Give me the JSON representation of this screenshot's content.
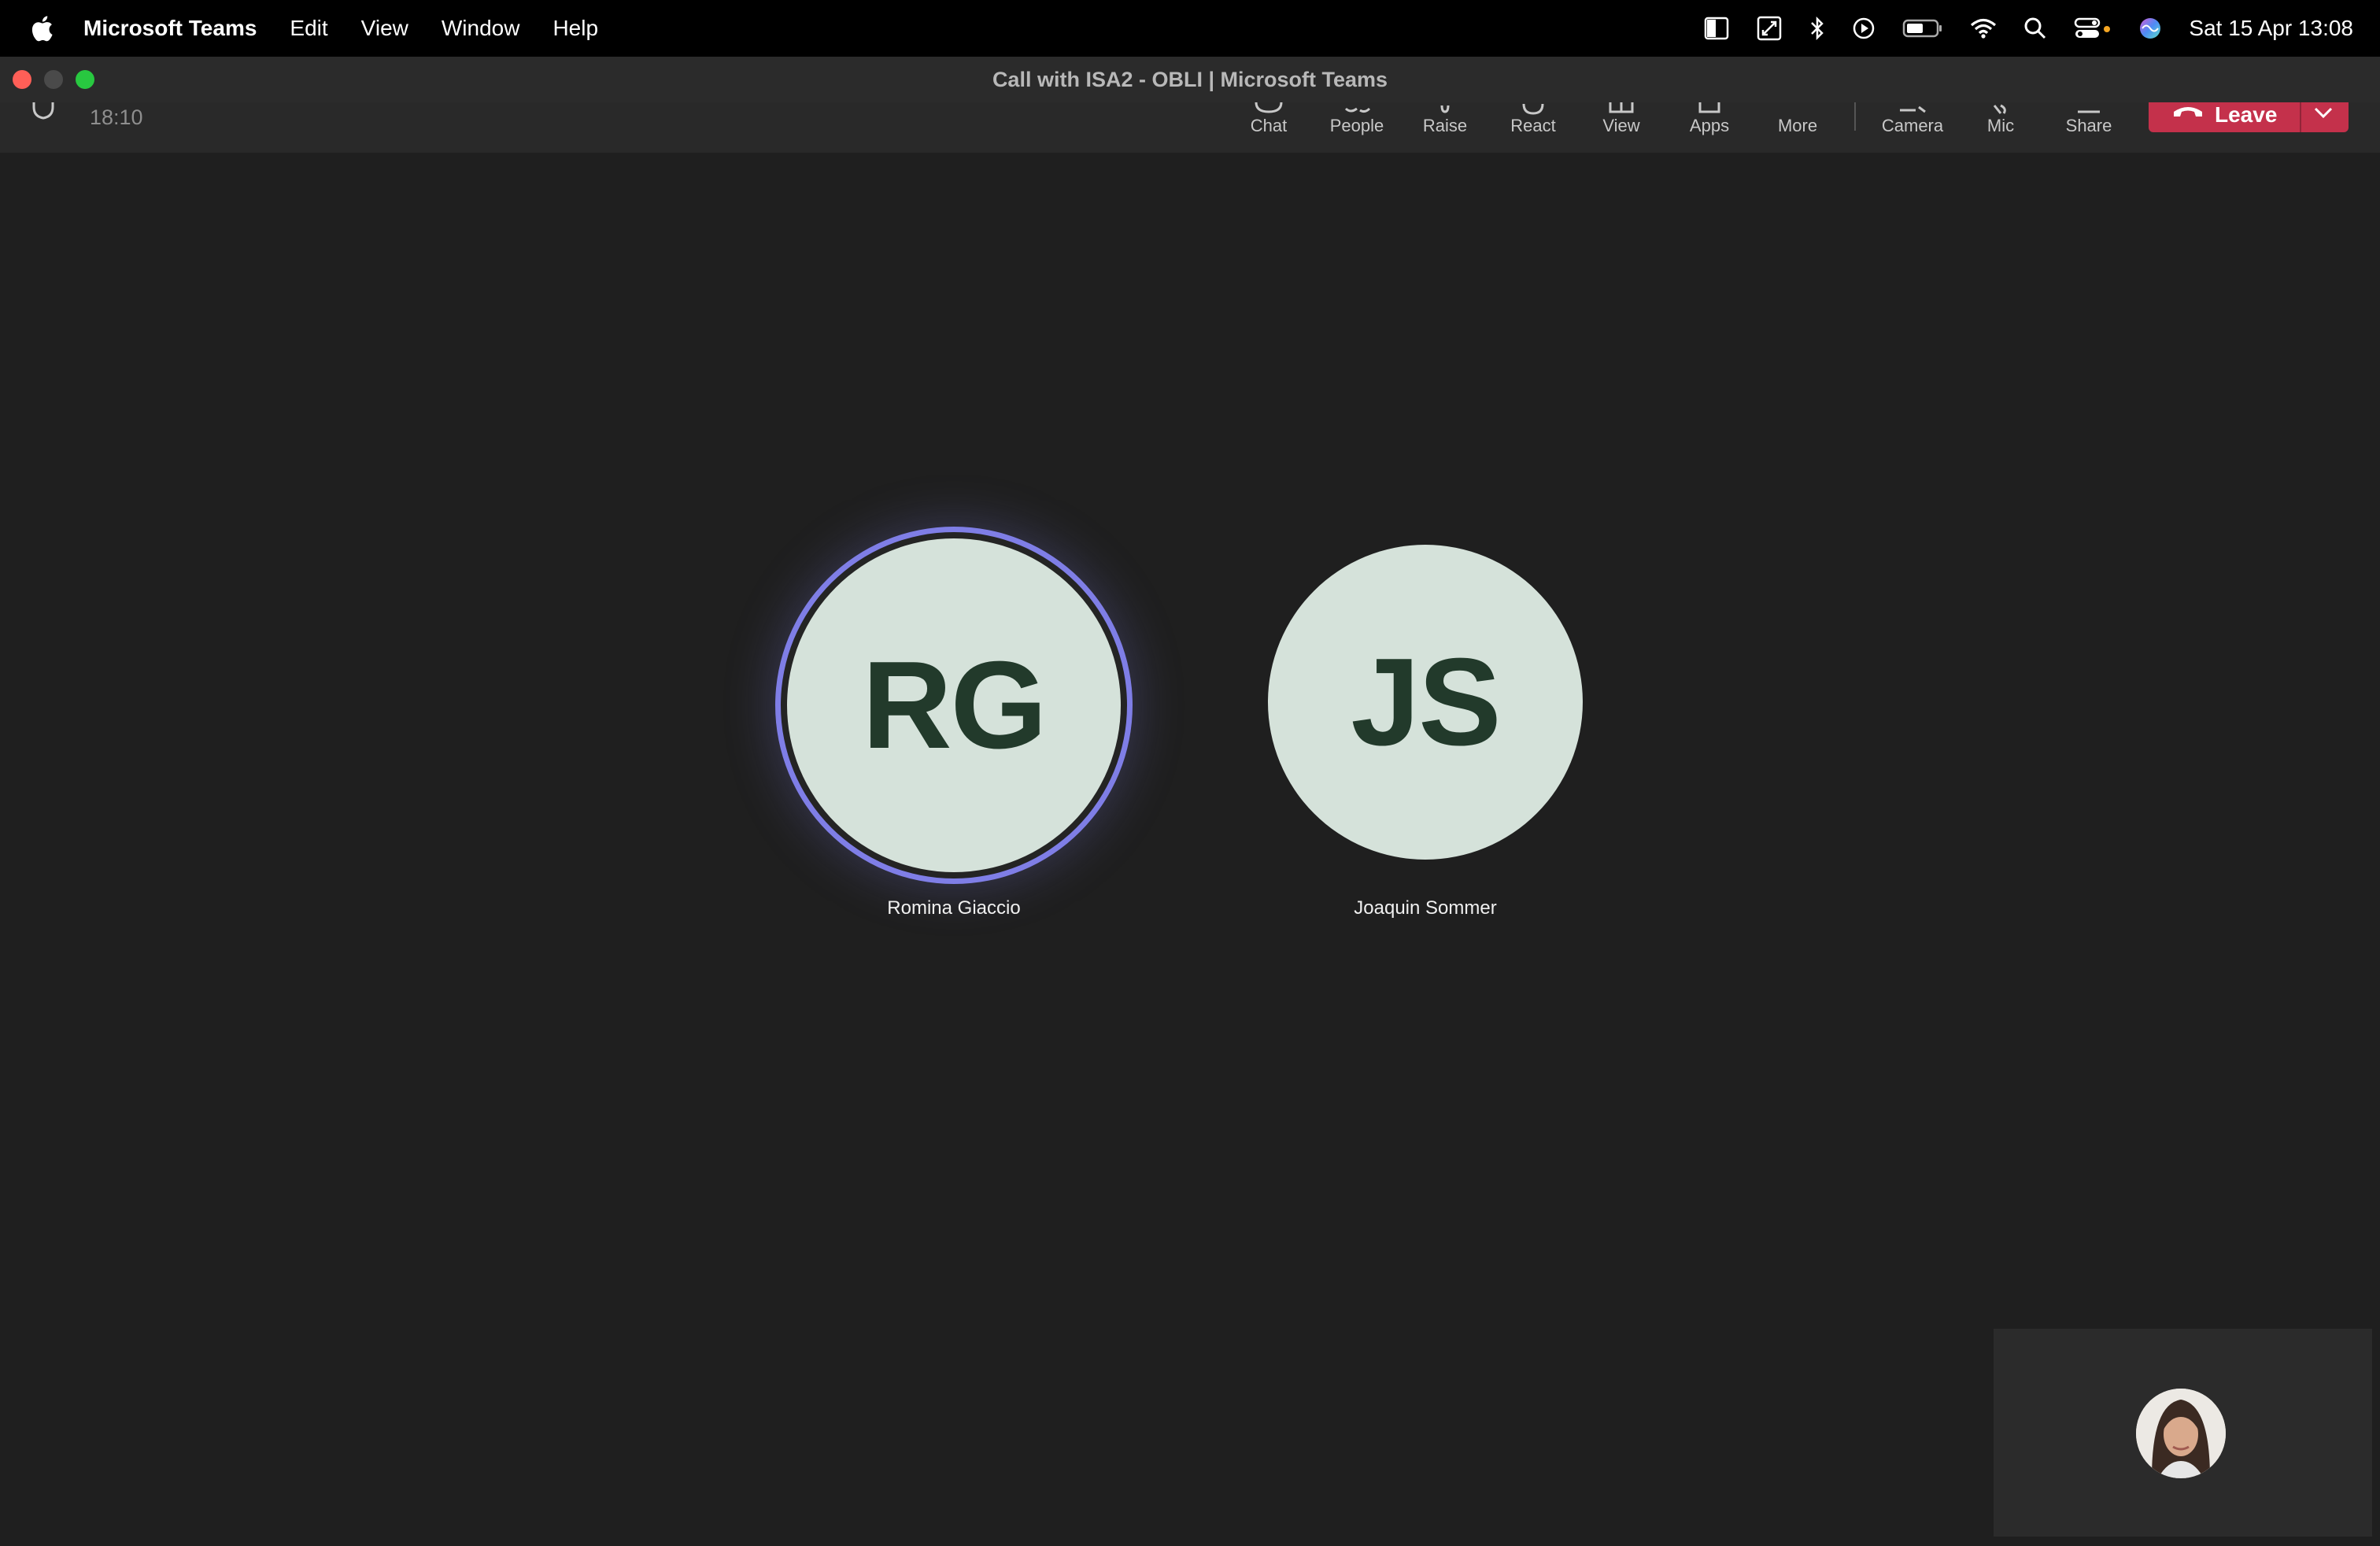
{
  "menubar": {
    "apple_icon": "apple-logo-icon",
    "app_name": "Microsoft Teams",
    "menus": [
      "Edit",
      "View",
      "Window",
      "Help"
    ],
    "status_icons": [
      "sidebar-icon",
      "screen-capture-icon",
      "bluetooth-icon",
      "play-icon",
      "battery-icon",
      "wifi-icon",
      "search-icon",
      "control-center-icon",
      "siri-icon"
    ],
    "datetime": "Sat 15 Apr  13:08"
  },
  "window": {
    "title": "Call with ISA2 - OBLI | Microsoft Teams"
  },
  "toolbar": {
    "timer": "18:10",
    "items": [
      {
        "label": "Chat",
        "icon": "chat-icon"
      },
      {
        "label": "People",
        "icon": "people-icon"
      },
      {
        "label": "Raise",
        "icon": "raise-hand-icon"
      },
      {
        "label": "React",
        "icon": "react-icon"
      },
      {
        "label": "View",
        "icon": "view-icon"
      },
      {
        "label": "Apps",
        "icon": "apps-icon"
      },
      {
        "label": "More",
        "icon": "more-icon"
      }
    ],
    "media": [
      {
        "label": "Camera",
        "icon": "camera-icon"
      },
      {
        "label": "Mic",
        "icon": "mic-icon"
      },
      {
        "label": "Share",
        "icon": "share-icon"
      }
    ],
    "leave_label": "Leave",
    "leave_color": "#c4314b"
  },
  "participants": [
    {
      "initials": "RG",
      "name": "Romina Giaccio",
      "speaking": true
    },
    {
      "initials": "JS",
      "name": "Joaquin Sommer",
      "speaking": false
    }
  ],
  "colors": {
    "speaking_ring": "#7f7ee6",
    "avatar_bg": "#d5e2da",
    "avatar_text": "#223a2b"
  }
}
